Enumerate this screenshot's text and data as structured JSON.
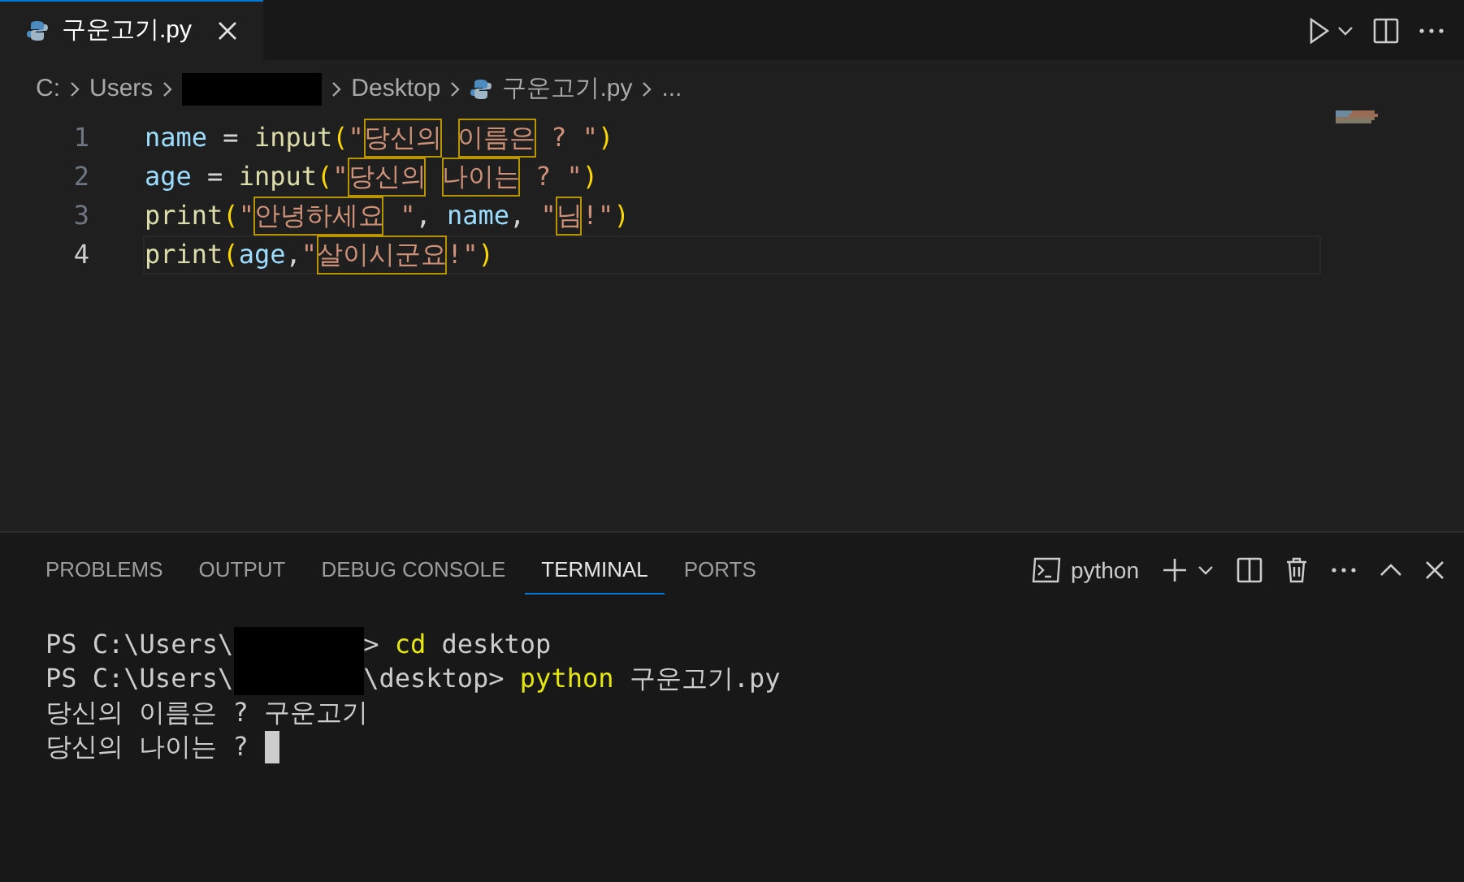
{
  "editor_tab": {
    "label": "구운고기.py",
    "selected": true
  },
  "breadcrumbs": [
    {
      "kind": "text",
      "text": "C:"
    },
    {
      "kind": "text",
      "text": "Users"
    },
    {
      "kind": "redacted"
    },
    {
      "kind": "text",
      "text": "Desktop"
    },
    {
      "kind": "file",
      "text": "구운고기.py"
    },
    {
      "kind": "text",
      "text": "..."
    }
  ],
  "code_lines": [
    {
      "number": "1",
      "current": false,
      "tokens": [
        {
          "kind": "var",
          "text": "name"
        },
        {
          "kind": "op",
          "text": " = "
        },
        {
          "kind": "fn",
          "text": "input"
        },
        {
          "kind": "bracket",
          "text": "("
        },
        {
          "kind": "str",
          "text": "\""
        },
        {
          "kind": "boxed",
          "text": "당신의"
        },
        {
          "kind": "space"
        },
        {
          "kind": "boxed",
          "text": "이름은"
        },
        {
          "kind": "str",
          "text": " ? \""
        },
        {
          "kind": "bracket",
          "text": ")"
        }
      ]
    },
    {
      "number": "2",
      "current": false,
      "tokens": [
        {
          "kind": "var",
          "text": "age"
        },
        {
          "kind": "op",
          "text": " = "
        },
        {
          "kind": "fn",
          "text": "input"
        },
        {
          "kind": "bracket",
          "text": "("
        },
        {
          "kind": "str",
          "text": "\""
        },
        {
          "kind": "boxed",
          "text": "당신의"
        },
        {
          "kind": "space"
        },
        {
          "kind": "boxed",
          "text": "나이는"
        },
        {
          "kind": "str",
          "text": " ? \""
        },
        {
          "kind": "bracket",
          "text": ")"
        }
      ]
    },
    {
      "number": "3",
      "current": false,
      "tokens": [
        {
          "kind": "fn",
          "text": "print"
        },
        {
          "kind": "bracket",
          "text": "("
        },
        {
          "kind": "str",
          "text": "\""
        },
        {
          "kind": "boxed",
          "text": "안녕하세요"
        },
        {
          "kind": "str",
          "text": " \""
        },
        {
          "kind": "op",
          "text": ", "
        },
        {
          "kind": "var",
          "text": "name"
        },
        {
          "kind": "op",
          "text": ", "
        },
        {
          "kind": "str",
          "text": "\""
        },
        {
          "kind": "boxed",
          "text": "님"
        },
        {
          "kind": "str",
          "text": "!\""
        },
        {
          "kind": "bracket",
          "text": ")"
        }
      ]
    },
    {
      "number": "4",
      "current": true,
      "tokens": [
        {
          "kind": "fn",
          "text": "print"
        },
        {
          "kind": "bracket",
          "text": "("
        },
        {
          "kind": "var",
          "text": "age"
        },
        {
          "kind": "op",
          "text": ","
        },
        {
          "kind": "str",
          "text": "\""
        },
        {
          "kind": "boxed",
          "text": "살이시군요"
        },
        {
          "kind": "str",
          "text": "!\""
        },
        {
          "kind": "bracket",
          "text": ")"
        }
      ]
    }
  ],
  "panel_tabs": [
    {
      "label": "PROBLEMS",
      "selected": false
    },
    {
      "label": "OUTPUT",
      "selected": false
    },
    {
      "label": "DEBUG CONSOLE",
      "selected": false
    },
    {
      "label": "TERMINAL",
      "selected": true
    },
    {
      "label": "PORTS",
      "selected": false
    }
  ],
  "terminal_profile": "python",
  "terminal_lines": [
    [
      {
        "kind": "plain",
        "text": "PS C:\\Users\\"
      },
      {
        "kind": "redacted"
      },
      {
        "kind": "plain",
        "text": "> "
      },
      {
        "kind": "cmd",
        "text": "cd"
      },
      {
        "kind": "plain",
        "text": " desktop"
      }
    ],
    [
      {
        "kind": "plain",
        "text": "PS C:\\Users\\"
      },
      {
        "kind": "redacted"
      },
      {
        "kind": "plain",
        "text": "\\desktop> "
      },
      {
        "kind": "cmd",
        "text": "python"
      },
      {
        "kind": "plain",
        "text": " 구운고기.py"
      }
    ],
    [
      {
        "kind": "plain",
        "text": "당신의 이름은 ? 구운고기"
      }
    ],
    [
      {
        "kind": "plain",
        "text": "당신의 나이는 ? "
      },
      {
        "kind": "cursor"
      }
    ]
  ]
}
